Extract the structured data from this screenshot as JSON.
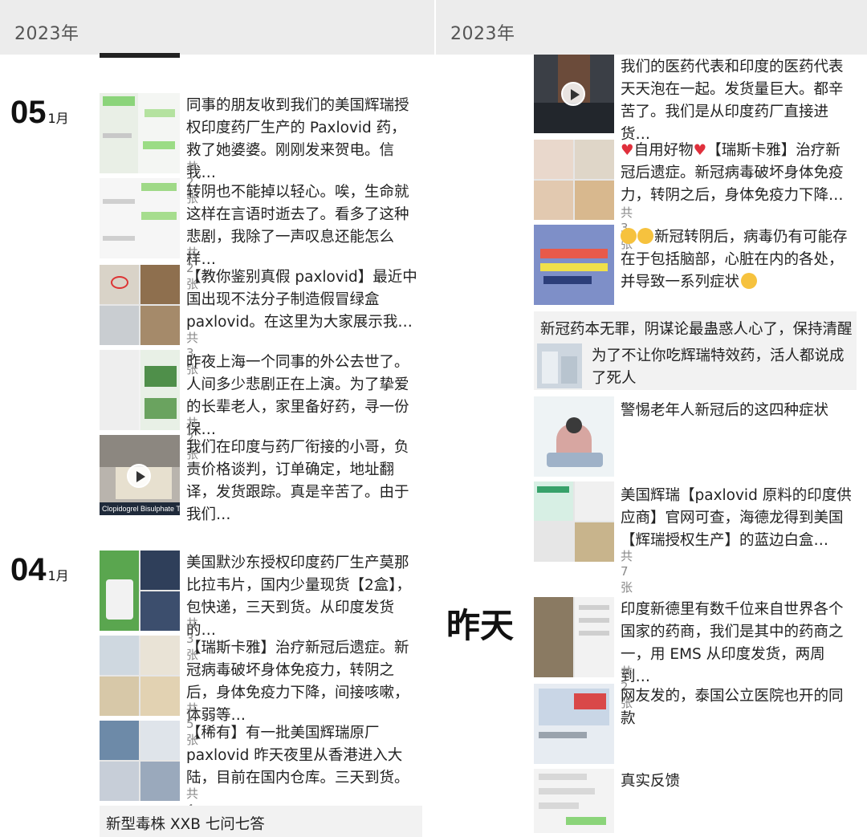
{
  "year_label": "2023年",
  "left": {
    "groups": [
      {
        "day": "05",
        "month": "1月",
        "posts": [
          {
            "text": "同事的朋友收到我们的美国辉瑞授权印度药厂生产的 Paxlovid 药，救了她婆婆。刚刚发来贺电。信我…",
            "count": "共2张"
          },
          {
            "text": "转阴也不能掉以轻心。唉，生命就这样在言语时逝去了。看多了这种悲剧，我除了一声叹息还能怎么样…",
            "count": "共2张"
          },
          {
            "text": "【教你鉴别真假 paxlovid】最近中国出现不法分子制造假冒绿盒 paxlovid。在这里为大家展示我…",
            "count": "共3张"
          },
          {
            "text": "昨夜上海一个同事的外公去世了。人间多少悲剧正在上演。为了挚爱的长辈老人，家里备好药，寻一份保…",
            "count": "共2张"
          },
          {
            "text": "我们在印度与药厂衔接的小哥，负责价格谈判，订单确定，地址翻译，发货跟踪。真是辛苦了。由于我们…",
            "count": "",
            "thumb_caption": "Clopidogrel Bisulphate T"
          }
        ]
      },
      {
        "day": "04",
        "month": "1月",
        "posts": [
          {
            "text": "美国默沙东授权印度药厂生产莫那比拉韦片，国内少量现货【2盒】，包快递，三天到货。从印度发货的…",
            "count": "共3张"
          },
          {
            "text": "【瑞斯卡雅】治疗新冠后遗症。新冠病毒破坏身体免疫力，转阴之后，身体免疫力下降，间接咳嗽，体弱等…",
            "count": "共5张"
          },
          {
            "text": "【稀有】有一批美国辉瑞原厂 paxlovid 昨天夜里从香港进入大陆，目前在国内仓库。三天到货。",
            "count": "共4张"
          }
        ],
        "share_title": "新型毒株 XXB 七问七答"
      }
    ]
  },
  "right": {
    "posts_top": [
      {
        "text": "我们的医药代表和印度的医药代表天天泡在一起。发货量巨大。都辛苦了。我们是从印度药厂直接进货…",
        "count": ""
      },
      {
        "text_prefix": "自用好物",
        "text": "【瑞斯卡雅】治疗新冠后遗症。新冠病毒破坏身体免疫力，转阴之后，身体免疫力下降…",
        "count": "共3张"
      },
      {
        "text": "新冠转阴后，病毒仍有可能存在于包括脑部，心脏在内的各处，并导致一系列症状",
        "count": ""
      }
    ],
    "share": {
      "title": "新冠药本无罪，阴谋论最蛊惑人心了，保持清醒",
      "text": "为了不让你吃辉瑞特效药，活人都说成了死人"
    },
    "posts_mid": [
      {
        "text": "警惕老年人新冠后的这四种症状",
        "count": ""
      },
      {
        "text": "美国辉瑞【paxlovid 原料的印度供应商】官网可查，海德龙得到美国【辉瑞授权生产】的蓝边白盒…",
        "count": "共7张"
      }
    ],
    "yesterday_label": "昨天",
    "posts_bottom": [
      {
        "text": "印度新德里有数千位来自世界各个国家的药商，我们是其中的药商之一，用 EMS 从印度发货，两周到…",
        "count": "共2张"
      },
      {
        "text": "网友发的，泰国公立医院也开的同款",
        "count": ""
      },
      {
        "text": "真实反馈",
        "count": ""
      }
    ]
  }
}
